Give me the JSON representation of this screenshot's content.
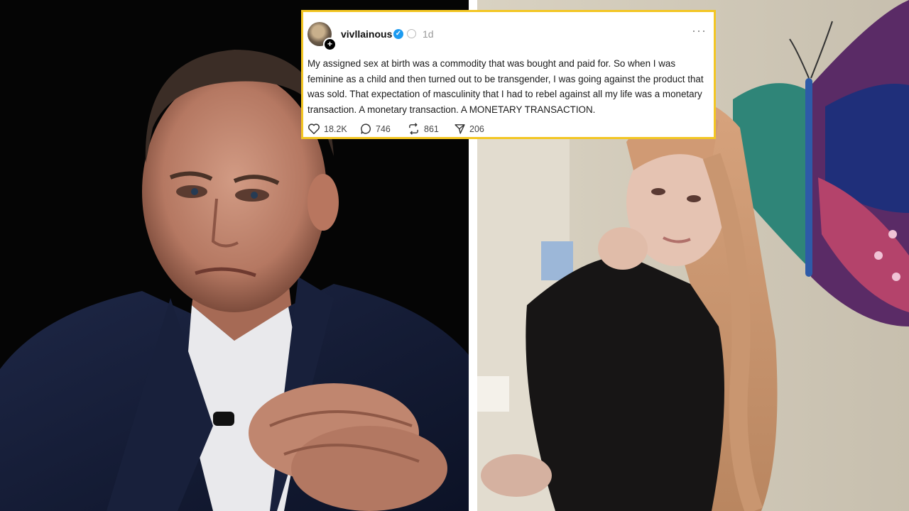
{
  "post": {
    "username": "vivllainous",
    "timestamp": "1d",
    "more_label": "···",
    "text": "My assigned sex at birth was a commodity that was bought and paid for. So when I was feminine as a child and then turned out to be transgender, I was going against the product that was sold. That expectation of masculinity that I had to rebel against all my life was a monetary transaction. A monetary transaction. A MONETARY TRANSACTION.",
    "likes": "18.2K",
    "replies": "746",
    "reposts": "861",
    "shares": "206"
  },
  "colors": {
    "card_border": "#f3c623",
    "verified": "#1d9bf0",
    "left_background": "#050505",
    "right_background": "#cfc6b6"
  },
  "icons": [
    "avatar-plus-icon",
    "verified-badge-icon",
    "ai-label-icon",
    "more-icon",
    "heart-icon",
    "comment-icon",
    "repost-icon",
    "share-icon"
  ]
}
